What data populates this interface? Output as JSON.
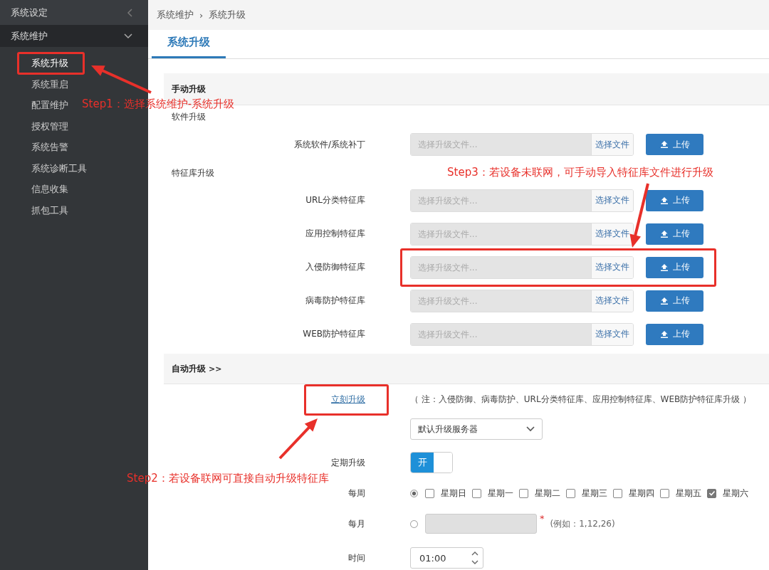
{
  "sidebar": {
    "groups": [
      {
        "label": "系统设定",
        "expanded": false
      },
      {
        "label": "系统维护",
        "expanded": true,
        "children": [
          {
            "label": "系统升级",
            "selected": true
          },
          {
            "label": "系统重启",
            "selected": false
          },
          {
            "label": "配置维护",
            "selected": false
          },
          {
            "label": "授权管理",
            "selected": false
          },
          {
            "label": "系统告警",
            "selected": false
          },
          {
            "label": "系统诊断工具",
            "selected": false
          },
          {
            "label": "信息收集",
            "selected": false
          },
          {
            "label": "抓包工具",
            "selected": false
          }
        ]
      }
    ]
  },
  "breadcrumb": {
    "items": [
      "系统维护",
      "系统升级"
    ],
    "separator": "›"
  },
  "tabs": [
    {
      "label": "系统升级",
      "selected": true
    }
  ],
  "manual": {
    "title": "手动升级",
    "groups": [
      {
        "heading": "软件升级",
        "rows": [
          {
            "label": "系统软件/系统补丁",
            "placeholder": "选择升级文件...",
            "browse": "选择文件",
            "upload": "上传"
          }
        ]
      },
      {
        "heading": "特征库升级",
        "rows": [
          {
            "label": "URL分类特征库",
            "placeholder": "选择升级文件...",
            "browse": "选择文件",
            "upload": "上传"
          },
          {
            "label": "应用控制特征库",
            "placeholder": "选择升级文件...",
            "browse": "选择文件",
            "upload": "上传"
          },
          {
            "label": "入侵防御特征库",
            "placeholder": "选择升级文件...",
            "browse": "选择文件",
            "upload": "上传"
          },
          {
            "label": "病毒防护特征库",
            "placeholder": "选择升级文件...",
            "browse": "选择文件",
            "upload": "上传"
          },
          {
            "label": "WEB防护特征库",
            "placeholder": "选择升级文件...",
            "browse": "选择文件",
            "upload": "上传"
          }
        ]
      }
    ]
  },
  "auto": {
    "title": "自动升级",
    "title_mark": ">>",
    "link": "立刻升级",
    "note": "（ 注：入侵防御、病毒防护、URL分类特征库、应用控制特征库、WEB防护特征库升级 ）",
    "server": "默认升级服务器",
    "schedule": {
      "label": "定期升级",
      "on": true,
      "text": "开"
    },
    "weekly": {
      "label": "每周",
      "selected": true,
      "days": [
        {
          "label": "星期日",
          "checked": false
        },
        {
          "label": "星期一",
          "checked": false
        },
        {
          "label": "星期二",
          "checked": false
        },
        {
          "label": "星期三",
          "checked": false
        },
        {
          "label": "星期四",
          "checked": false
        },
        {
          "label": "星期五",
          "checked": false
        },
        {
          "label": "星期六",
          "checked": true
        }
      ]
    },
    "monthly": {
      "label": "每月",
      "selected": false,
      "required": "*",
      "hint": "(例如：1,12,26)"
    },
    "time": {
      "label": "时间",
      "value": "01:00"
    }
  },
  "annotations": [
    {
      "text": "Step1：选择系统维护-系统升级"
    },
    {
      "text": "Step3：若设备未联网，可手动导入特征库文件进行升级"
    },
    {
      "text": "Step2：若设备联网可直接自动升级特征库"
    }
  ]
}
